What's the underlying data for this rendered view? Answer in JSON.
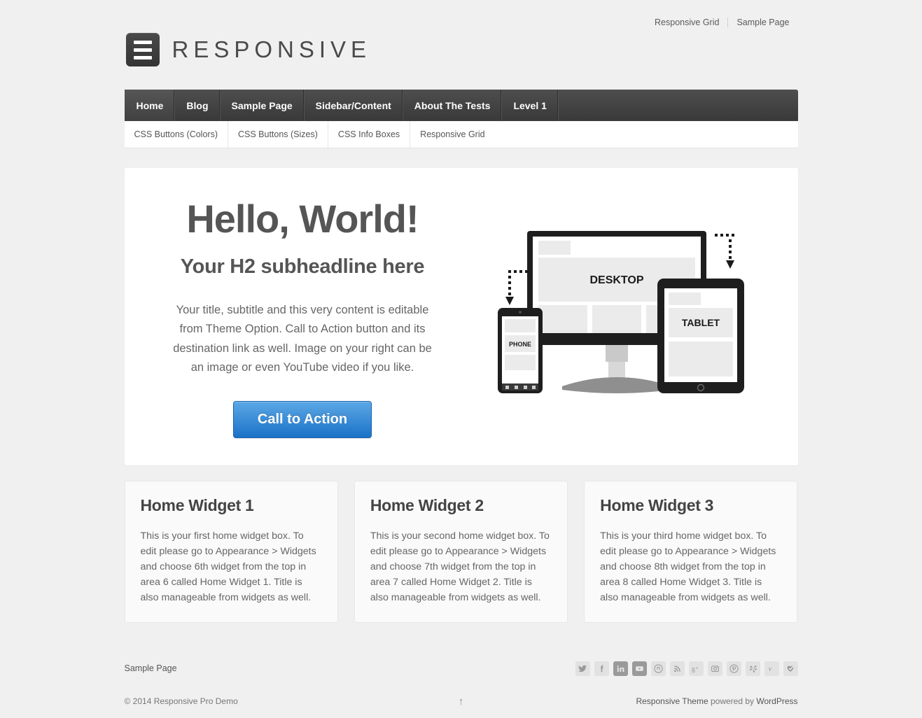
{
  "top_nav": {
    "items": [
      {
        "label": "Responsive Grid"
      },
      {
        "label": "Sample Page"
      }
    ]
  },
  "logo": {
    "text": "RESPONSIVE",
    "icon": "hamburger-icon"
  },
  "main_nav": {
    "items": [
      {
        "label": "Home",
        "active": true
      },
      {
        "label": "Blog",
        "active": false
      },
      {
        "label": "Sample Page",
        "active": false
      },
      {
        "label": "Sidebar/Content",
        "active": false
      },
      {
        "label": "About The Tests",
        "active": false
      },
      {
        "label": "Level 1",
        "active": false
      }
    ]
  },
  "sub_nav": {
    "items": [
      {
        "label": "CSS Buttons (Colors)"
      },
      {
        "label": "CSS Buttons (Sizes)"
      },
      {
        "label": "CSS Info Boxes"
      },
      {
        "label": "Responsive Grid"
      }
    ]
  },
  "hero": {
    "headline": "Hello, World!",
    "subheadline": "Your H2 subheadline here",
    "body": "Your title, subtitle and this very content is editable from Theme Option. Call to Action button and its destination link as well. Image on your right can be an image or even YouTube video if you like.",
    "cta_label": "Call to Action",
    "image": {
      "desktop_label": "DESKTOP",
      "tablet_label": "TABLET",
      "phone_label": "PHONE"
    }
  },
  "widgets": [
    {
      "title": "Home Widget 1",
      "body": "This is your first home widget box. To edit please go to Appearance > Widgets and choose 6th widget from the top in area 6 called Home Widget 1. Title is also manageable from widgets as well."
    },
    {
      "title": "Home Widget 2",
      "body": "This is your second home widget box. To edit please go to Appearance > Widgets and choose 7th widget from the top in area 7 called Home Widget 2. Title is also manageable from widgets as well."
    },
    {
      "title": "Home Widget 3",
      "body": "This is your third home widget box. To edit please go to Appearance > Widgets and choose 8th widget from the top in area 8 called Home Widget 3. Title is also manageable from widgets as well."
    }
  ],
  "footer": {
    "menu": [
      {
        "label": "Sample Page"
      }
    ],
    "social": [
      {
        "name": "twitter-icon"
      },
      {
        "name": "facebook-icon"
      },
      {
        "name": "linkedin-icon"
      },
      {
        "name": "youtube-icon"
      },
      {
        "name": "stumbleupon-icon"
      },
      {
        "name": "rss-icon"
      },
      {
        "name": "googleplus-icon"
      },
      {
        "name": "instagram-icon"
      },
      {
        "name": "pinterest-icon"
      },
      {
        "name": "yelp-icon"
      },
      {
        "name": "vimeo-icon"
      },
      {
        "name": "heart-check-icon"
      }
    ],
    "copyright": "© 2014 Responsive Pro Demo",
    "back_to_top": "↑",
    "credit": {
      "theme": "Responsive Theme",
      "powered_by": " powered by ",
      "platform": "WordPress"
    }
  },
  "colors": {
    "page_bg": "#f0f0f0",
    "nav_dark": "#3f3f3f",
    "cta_blue": "#1b72c7",
    "text_gray": "#555555"
  }
}
